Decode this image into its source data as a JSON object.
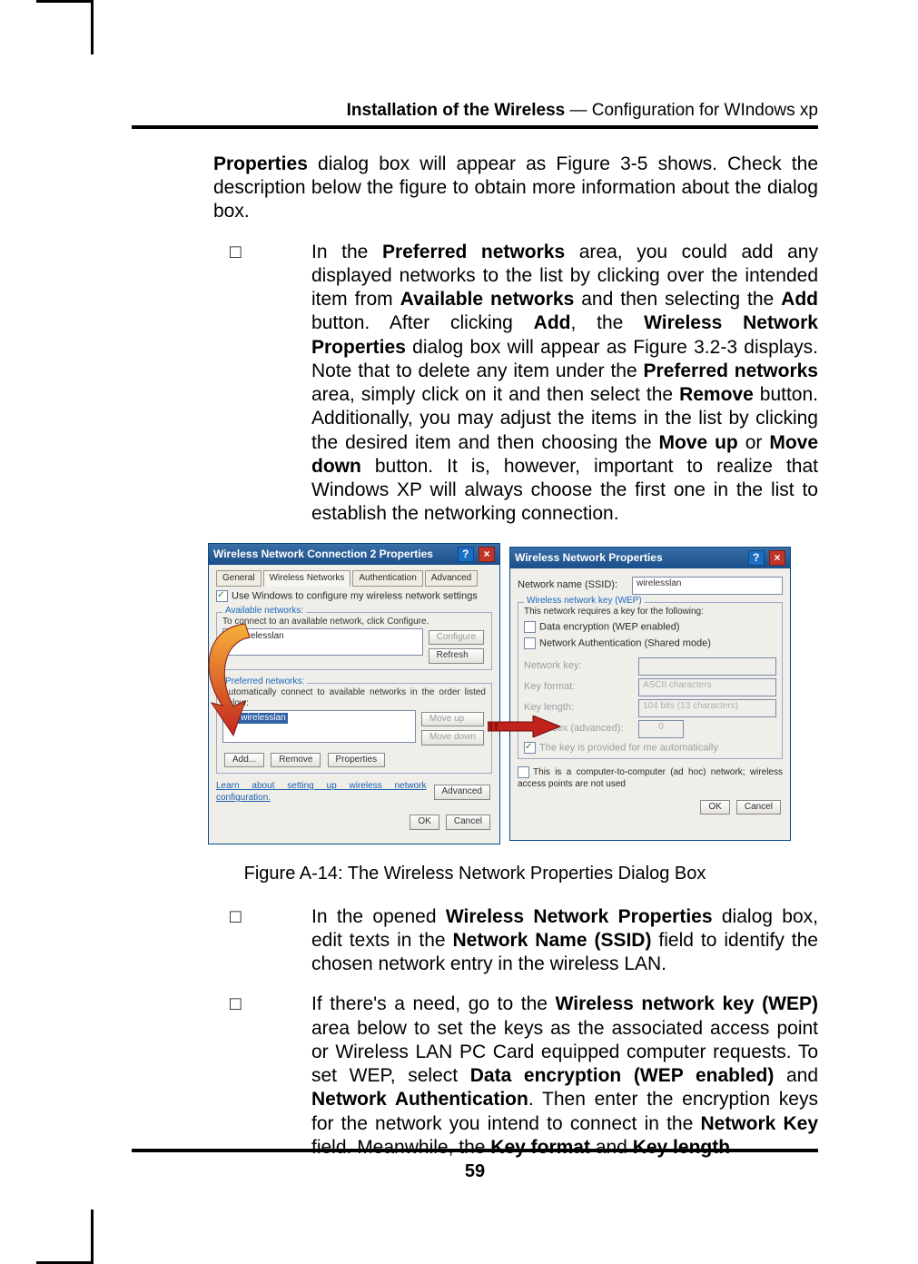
{
  "header": {
    "bold": "Installation of the Wireless",
    "plain": " — Configuration for WIndows xp"
  },
  "intro_para": "Properties  dialog  box  will  appear  as  Figure  3-5  shows.  Check  the  description  below  the  figure  to  obtain  more  information  about  the  dialog box.",
  "bullet1_plain": [
    "In  the  ",
    "  area,  you  could  add  any  displayed  networks to the list by clicking over the intended item from ",
    " and then selecting the ",
    " button. After clicking ",
    ", the ",
    " dialog box will appear as Figure 3.2-3 displays. Note that to delete any item under the ",
    " area,  simply  click  on  it  and  then  select  the  ",
    "  button.  Additionally,  you  may  adjust  the  items  in  the  list  by  clicking  the  desired item and then choosing the ",
    " or ",
    " button. It is, however, important to realize that Windows XP will always choose the first one in the list to establish the networking connection."
  ],
  "bullet1_bold": [
    "Preferred  networks",
    "Available networks",
    "Add",
    "Add",
    "Wireless Network Properties",
    "Preferred networks",
    "Remove",
    "Move up",
    "Move down"
  ],
  "caption": "Figure A-14: The Wireless Network Properties Dialog Box",
  "bullet2_plain": [
    "In the opened ",
    " dialog box, edit texts in the ",
    " field to identify the chosen network entry in the wireless LAN."
  ],
  "bullet2_bold": [
    "Wireless Network Properties",
    "Network Name (SSID)"
  ],
  "bullet3_plain": [
    "If there's a need, go to the ",
    " area below to set the keys as the associated access point or Wireless LAN PC Card  equipped  computer  requests.  To  set  WEP,  select  ",
    " and ",
    ".  Then enter the encryption keys for the network you intend to connect in the ",
    " field.  Meanwhile,  the ",
    " and "
  ],
  "bullet3_bold": [
    "Wireless network key (WEP)",
    "Data encryption  (WEP  enabled)",
    "Network  Authentication",
    "Network  Key",
    "Key  format",
    "Key  length"
  ],
  "page_number": "59",
  "dlg1": {
    "title": "Wireless Network Connection 2 Properties",
    "tabs": [
      "General",
      "Wireless Networks",
      "Authentication",
      "Advanced"
    ],
    "use_win": "Use Windows to configure my wireless network settings",
    "avail_title": "Available networks:",
    "avail_help": "To connect to an available network, click Configure.",
    "item": "wirelesslan",
    "btn_configure": "Configure",
    "btn_refresh": "Refresh",
    "pref_title": "Preferred networks:",
    "pref_help": "Automatically connect to available networks in the order listed below:",
    "btn_moveup": "Move up",
    "btn_movedown": "Move down",
    "btn_add": "Add...",
    "btn_remove": "Remove",
    "btn_props": "Properties",
    "learn": "Learn about setting up wireless network configuration.",
    "btn_adv": "Advanced",
    "btn_ok": "OK",
    "btn_cancel": "Cancel"
  },
  "dlg2": {
    "title": "Wireless Network Properties",
    "ssid_label": "Network name (SSID):",
    "ssid_value": "wirelesslan",
    "wep_group": "Wireless network key (WEP)",
    "wep_help": "This network requires a key for the following:",
    "chk_data": "Data encryption (WEP enabled)",
    "chk_auth": "Network Authentication (Shared mode)",
    "key_label": "Network key:",
    "fmt_label": "Key format:",
    "fmt_value": "ASCII characters",
    "len_label": "Key length:",
    "len_value": "104 bits (13 characters)",
    "idx_label": "Key index (advanced):",
    "idx_value": "0",
    "auto_key": "The key is provided for me automatically",
    "adhoc": "This is a computer-to-computer (ad hoc) network; wireless access points are not used",
    "btn_ok": "OK",
    "btn_cancel": "Cancel"
  }
}
